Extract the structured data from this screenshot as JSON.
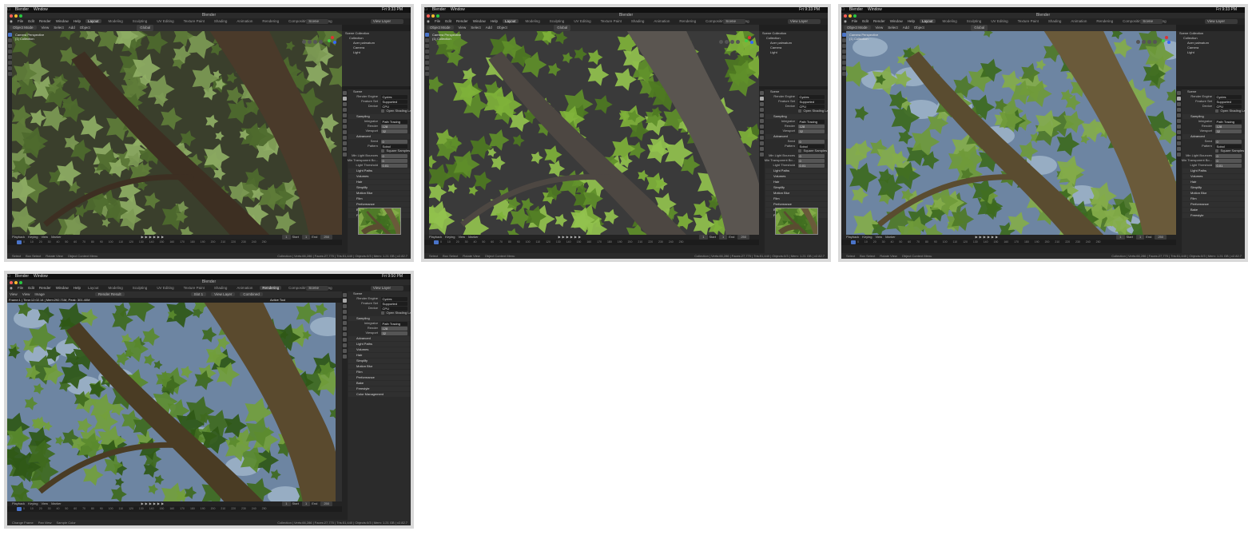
{
  "mac_menu": {
    "app": "Blender",
    "menu": "Window"
  },
  "window_title": "Blender",
  "top_menu": [
    "File",
    "Edit",
    "Render",
    "Window",
    "Help"
  ],
  "workspaces": [
    "Layout",
    "Modeling",
    "Sculpting",
    "UV Editing",
    "Texture Paint",
    "Shading",
    "Animation",
    "Rendering",
    "Compositing",
    "Scripting"
  ],
  "scene_label": "Scene",
  "view_layer_label": "View Layer",
  "header3d": {
    "mode": "Object Mode",
    "view": "View",
    "select": "Select",
    "add": "Add",
    "object": "Object",
    "global": "Global"
  },
  "vp_info": [
    "Camera Perspective",
    "(1) Collection"
  ],
  "outliner": [
    "Scene Collection",
    "Collection",
    "Acer palmatum",
    "Camera",
    "Light"
  ],
  "props": {
    "scene": "Scene",
    "render_engine_label": "Render Engine",
    "render_engine": "Cycles",
    "feature_set_label": "Feature Set",
    "feature_set": "Supported",
    "device_label": "Device",
    "device": "CPU",
    "osl_label": "Open Shading Language",
    "sampling": "Sampling",
    "integrator_label": "Integrator",
    "integrator": "Path Tracing",
    "render_label": "Render",
    "render_val": "128",
    "viewport_label": "Viewport",
    "viewport_val": "32",
    "advanced": "Advanced",
    "seed_label": "Seed",
    "seed_val": "0",
    "pattern_label": "Pattern",
    "pattern_val": "Sobol",
    "square_label": "Square Samples",
    "minlight_label": "Min Light Bounces",
    "minlight_val": "0",
    "mintrans_label": "Min Transparent Bo...",
    "mintrans_val": "0",
    "lightthr_label": "Light Threshold",
    "lightthr_val": "0.01",
    "light_paths": "Light Paths",
    "volumes": "Volumes",
    "hair": "Hair",
    "simplify": "Simplify",
    "motion_blur": "Motion Blur",
    "film": "Film",
    "performance": "Performance",
    "bake": "Bake",
    "freestyle": "Freestyle",
    "color_management": "Color Management"
  },
  "timeline": {
    "playback": "Playback",
    "keying": "Keying",
    "view": "View",
    "marker": "Marker",
    "frame": "1",
    "start_label": "Start",
    "start": "1",
    "end_label": "End",
    "end": "250"
  },
  "ruler": "0 10 20 30 40 50 60 70 80 90 100 110 120 130 140 150 160 170 180 190 200 210 220 230 240 250",
  "status": {
    "select": "Select",
    "box_select": "Box Select",
    "rotate_view": "Rotate View",
    "context_menu": "Object Context Menu",
    "stats": "Collection | Verts:66,286 | Faces:27,770 | Tris:51,440 | Objects:0/3 | Mem: 1.21 GB | v2.82.7"
  },
  "render_window": {
    "menu": [
      "View",
      "View",
      "Image"
    ],
    "render_result": "Render Result",
    "slot": "Slot 1",
    "view_layer": "View Layer",
    "combined": "Combined",
    "active_tool": "Active Tool",
    "frame_info": "Frame:1 | Time:12:02.14 | Mem:292.71M, Peak: 301.40M",
    "status_change_frame": "Change Frame",
    "status_pan": "Pan View",
    "status_sample": "Sample Color",
    "clock": "Fri 9:50 PM"
  },
  "clock_a": "Fri 9:33 PM",
  "clock_b": "Fri 9:33 PM",
  "clock_c": "Fri 9:33 PM"
}
